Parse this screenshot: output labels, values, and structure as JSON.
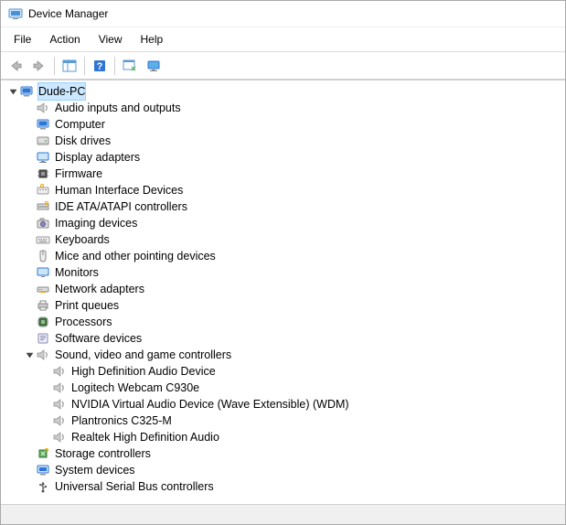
{
  "window": {
    "title": "Device Manager"
  },
  "menu": {
    "file": "File",
    "action": "Action",
    "view": "View",
    "help": "Help"
  },
  "tree": {
    "root": {
      "label": "Dude-PC",
      "icon": "computer-icon",
      "expanded": true,
      "selected": true,
      "children": [
        {
          "label": "Audio inputs and outputs",
          "icon": "speaker-icon",
          "expanded": false
        },
        {
          "label": "Computer",
          "icon": "computer-icon",
          "expanded": false
        },
        {
          "label": "Disk drives",
          "icon": "disk-icon",
          "expanded": false
        },
        {
          "label": "Display adapters",
          "icon": "display-icon",
          "expanded": false
        },
        {
          "label": "Firmware",
          "icon": "chip-icon",
          "expanded": false
        },
        {
          "label": "Human Interface Devices",
          "icon": "hid-icon",
          "expanded": false
        },
        {
          "label": "IDE ATA/ATAPI controllers",
          "icon": "ide-icon",
          "expanded": false
        },
        {
          "label": "Imaging devices",
          "icon": "camera-icon",
          "expanded": false
        },
        {
          "label": "Keyboards",
          "icon": "keyboard-icon",
          "expanded": false
        },
        {
          "label": "Mice and other pointing devices",
          "icon": "mouse-icon",
          "expanded": false
        },
        {
          "label": "Monitors",
          "icon": "monitor-icon",
          "expanded": false
        },
        {
          "label": "Network adapters",
          "icon": "network-icon",
          "expanded": false
        },
        {
          "label": "Print queues",
          "icon": "printer-icon",
          "expanded": false
        },
        {
          "label": "Processors",
          "icon": "cpu-icon",
          "expanded": false
        },
        {
          "label": "Software devices",
          "icon": "software-icon",
          "expanded": false
        },
        {
          "label": "Sound, video and game controllers",
          "icon": "speaker-icon",
          "expanded": true,
          "children": [
            {
              "label": "High Definition Audio Device",
              "icon": "speaker-icon"
            },
            {
              "label": "Logitech Webcam C930e",
              "icon": "speaker-icon"
            },
            {
              "label": "NVIDIA Virtual Audio Device (Wave Extensible) (WDM)",
              "icon": "speaker-icon"
            },
            {
              "label": "Plantronics C325-M",
              "icon": "speaker-icon"
            },
            {
              "label": "Realtek High Definition Audio",
              "icon": "speaker-icon"
            }
          ]
        },
        {
          "label": "Storage controllers",
          "icon": "storage-icon",
          "expanded": false
        },
        {
          "label": "System devices",
          "icon": "system-icon",
          "expanded": false
        },
        {
          "label": "Universal Serial Bus controllers",
          "icon": "usb-icon",
          "expanded": false
        }
      ]
    }
  }
}
